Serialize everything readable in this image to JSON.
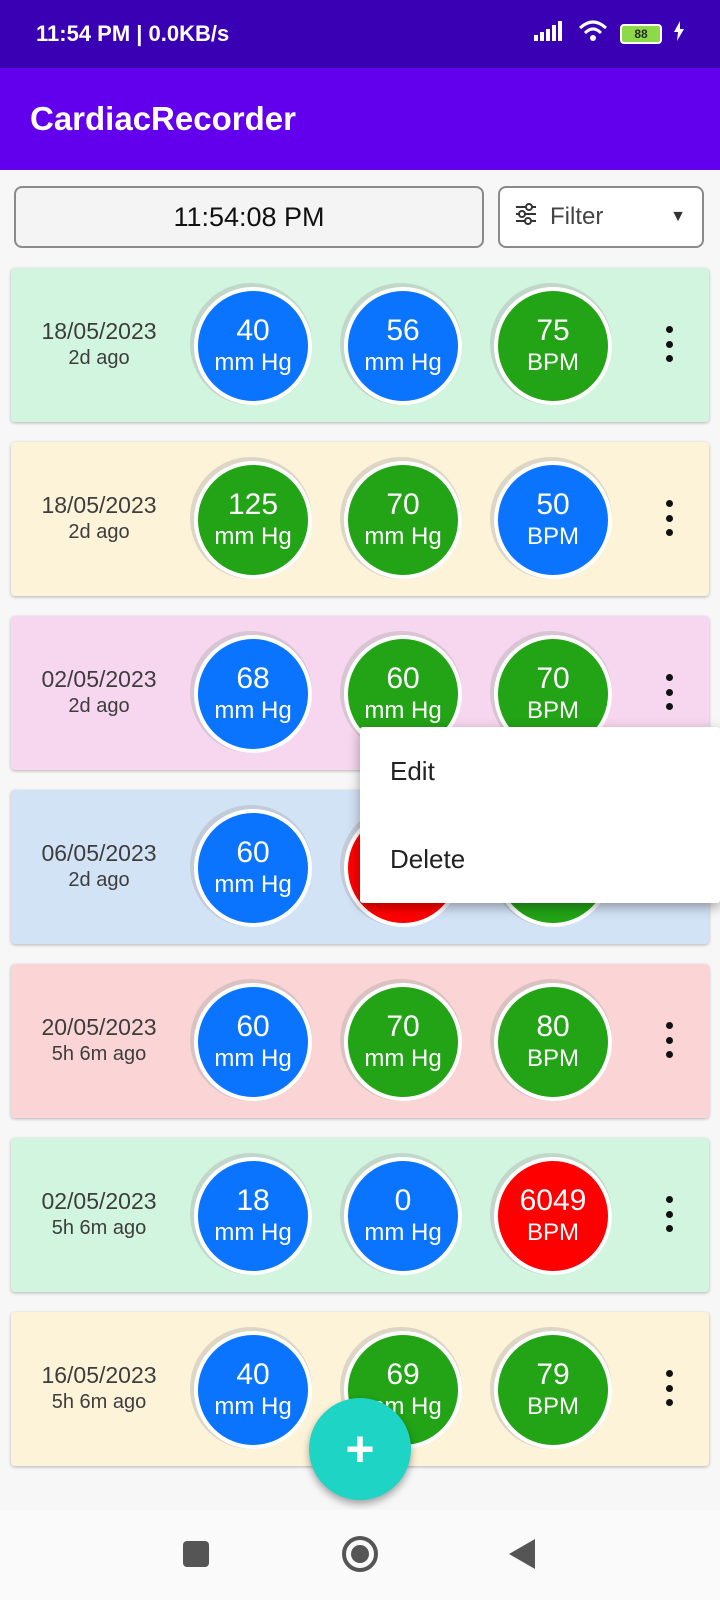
{
  "status_bar": {
    "time_speed": "11:54 PM | 0.0KB/s",
    "battery": "88",
    "icons": [
      "signal-icon",
      "wifi-icon",
      "battery-icon",
      "charging-icon"
    ]
  },
  "app": {
    "title": "CardiacRecorder"
  },
  "toolbar": {
    "clock": "11:54:08 PM",
    "filter_label": "Filter"
  },
  "colors": {
    "blue": "#0a74ff",
    "green": "#23a316",
    "red": "#ff0000",
    "mint": "#d2f5df",
    "cream": "#fdf3d9",
    "pink": "#f7d7ef",
    "lightblue": "#d3e3f6",
    "salmon": "#fbd5d5"
  },
  "records": [
    {
      "date": "18/05/2023",
      "ago": "2d ago",
      "bg": "#d2f5df",
      "systolic": "40",
      "diastolic": "56",
      "pulse": "75",
      "sys_unit": "mm Hg",
      "dia_unit": "mm Hg",
      "pulse_unit": "BPM",
      "sys_color": "#0a74ff",
      "dia_color": "#0a74ff",
      "pulse_color": "#23a316"
    },
    {
      "date": "18/05/2023",
      "ago": "2d ago",
      "bg": "#fdf3d9",
      "systolic": "125",
      "diastolic": "70",
      "pulse": "50",
      "sys_unit": "mm Hg",
      "dia_unit": "mm Hg",
      "pulse_unit": "BPM",
      "sys_color": "#23a316",
      "dia_color": "#23a316",
      "pulse_color": "#0a74ff"
    },
    {
      "date": "02/05/2023",
      "ago": "2d ago",
      "bg": "#f7d7ef",
      "systolic": "68",
      "diastolic": "60",
      "pulse": "70",
      "sys_unit": "mm Hg",
      "dia_unit": "mm Hg",
      "pulse_unit": "BPM",
      "sys_color": "#0a74ff",
      "dia_color": "#23a316",
      "pulse_color": "#23a316"
    },
    {
      "date": "06/05/2023",
      "ago": "2d ago",
      "bg": "#d3e3f6",
      "systolic": "60",
      "diastolic": "",
      "pulse": "",
      "sys_unit": "mm Hg",
      "dia_unit": "mm Hg",
      "pulse_unit": "BPM",
      "sys_color": "#0a74ff",
      "dia_color": "#ff0000",
      "pulse_color": "#23a316"
    },
    {
      "date": "20/05/2023",
      "ago": "5h 6m ago",
      "bg": "#fbd5d5",
      "systolic": "60",
      "diastolic": "70",
      "pulse": "80",
      "sys_unit": "mm Hg",
      "dia_unit": "mm Hg",
      "pulse_unit": "BPM",
      "sys_color": "#0a74ff",
      "dia_color": "#23a316",
      "pulse_color": "#23a316"
    },
    {
      "date": "02/05/2023",
      "ago": "5h 6m ago",
      "bg": "#d2f5df",
      "systolic": "18",
      "diastolic": "0",
      "pulse": "6049",
      "sys_unit": "mm Hg",
      "dia_unit": "mm Hg",
      "pulse_unit": "BPM",
      "sys_color": "#0a74ff",
      "dia_color": "#0a74ff",
      "pulse_color": "#ff0000"
    },
    {
      "date": "16/05/2023",
      "ago": "5h 6m ago",
      "bg": "#fdf3d9",
      "systolic": "40",
      "diastolic": "69",
      "pulse": "79",
      "sys_unit": "mm Hg",
      "dia_unit": "mm Hg",
      "pulse_unit": "BPM",
      "sys_color": "#0a74ff",
      "dia_color": "#23a316",
      "pulse_color": "#23a316"
    }
  ],
  "context_menu": {
    "edit": "Edit",
    "delete": "Delete"
  },
  "fab": {
    "label": "+"
  }
}
